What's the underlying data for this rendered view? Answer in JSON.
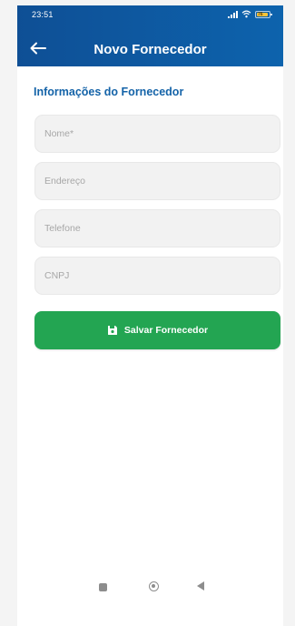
{
  "status_bar": {
    "time": "23:51",
    "battery": "76"
  },
  "app_bar": {
    "title": "Novo Fornecedor",
    "back_icon": "arrow-left-icon",
    "background_color": "#0e59a1"
  },
  "form": {
    "section_title": "Informações do Fornecedor",
    "fields": {
      "nome": {
        "placeholder": "Nome*",
        "value": ""
      },
      "endereco": {
        "placeholder": "Endereço",
        "value": ""
      },
      "telefone": {
        "placeholder": "Telefone",
        "value": ""
      },
      "cnpj": {
        "placeholder": "CNPJ",
        "value": ""
      }
    },
    "save_button": {
      "label": "Salvar Fornecedor",
      "icon": "floppy-disk-icon",
      "color": "#23a552"
    }
  },
  "nav_bar": {
    "recents_icon": "square-icon",
    "home_icon": "circle-icon",
    "back_icon": "triangle-back-icon"
  }
}
